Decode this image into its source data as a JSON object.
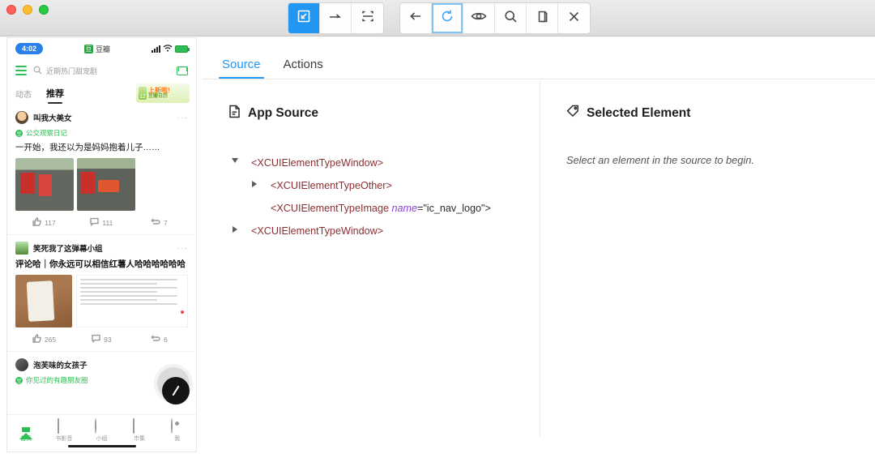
{
  "window": {
    "traffic_lights": [
      "close",
      "minimize",
      "maximize"
    ]
  },
  "toolbar": {
    "left_group": [
      {
        "name": "select-element",
        "icon": "cursor-select-icon",
        "active": true
      },
      {
        "name": "swipe",
        "icon": "arrow-right-icon",
        "active": false
      },
      {
        "name": "tap-by-coordinates",
        "icon": "crop-frame-icon",
        "active": false
      }
    ],
    "right_group": [
      {
        "name": "back",
        "icon": "arrow-left-icon",
        "active": false
      },
      {
        "name": "refresh",
        "icon": "refresh-icon",
        "active": true
      },
      {
        "name": "inspect",
        "icon": "eye-icon",
        "active": false
      },
      {
        "name": "search",
        "icon": "search-icon",
        "active": false
      },
      {
        "name": "copy",
        "icon": "copy-icon",
        "active": false
      },
      {
        "name": "close-session",
        "icon": "close-x-icon",
        "active": false
      }
    ]
  },
  "tabs": [
    {
      "label": "Source",
      "selected": true
    },
    {
      "label": "Actions",
      "selected": false
    }
  ],
  "source_panel": {
    "title": "App Source",
    "icon": "document-icon",
    "tree": [
      {
        "depth": 0,
        "twisty": "open",
        "tag": "<XCUIElementTypeWindow>"
      },
      {
        "depth": 1,
        "twisty": "closed",
        "tag": "<XCUIElementTypeOther>"
      },
      {
        "depth": 2,
        "twisty": "none",
        "tag": "<XCUIElementTypeImage",
        "attr_name": "name",
        "attr_value": "=\"ic_nav_logo\">"
      },
      {
        "depth": 0,
        "twisty": "closed",
        "tag": "<XCUIElementTypeWindow>"
      }
    ]
  },
  "selected_panel": {
    "title": "Selected Element",
    "icon": "tag-icon",
    "empty_message": "Select an element in the source to begin."
  },
  "device_screen": {
    "status_bar": {
      "time": "4:02",
      "app_name": "豆瓣",
      "app_badge": "豆"
    },
    "search_placeholder": "近期热门甜宠剧",
    "nav_tabs": [
      {
        "label": "动态",
        "selected": false
      },
      {
        "label": "推荐",
        "selected": true
      }
    ],
    "promo": {
      "headline": "上新啦!",
      "subline": "豆瓣日历",
      "number": "12"
    },
    "posts": [
      {
        "author": "叫我大美女",
        "group": "公交观察日记",
        "title": "一开始，我还以为是妈妈抱着儿子……",
        "likes": "117",
        "comments": "111",
        "reposts": "7"
      },
      {
        "author": "笑死我了这弹幕小组",
        "group": "",
        "title": "评论哈｜你永远可以相信红薯人哈哈哈哈哈哈",
        "likes": "265",
        "comments": "93",
        "reposts": "6"
      },
      {
        "author": "泡芙味的女孩子",
        "group": "你见过的有趣朋友圈",
        "title": "",
        "likes": "",
        "comments": "",
        "reposts": ""
      }
    ],
    "bottom_nav": [
      {
        "label": "首页",
        "selected": true
      },
      {
        "label": "书影音",
        "selected": false
      },
      {
        "label": "小组",
        "selected": false
      },
      {
        "label": "市集",
        "selected": false
      },
      {
        "label": "我",
        "selected": false
      }
    ]
  },
  "colors": {
    "accent_blue": "#2196f3",
    "tag_maroon": "#8b2f33",
    "attr_purple": "#8a3fd1",
    "douban_green": "#2fbd55"
  }
}
